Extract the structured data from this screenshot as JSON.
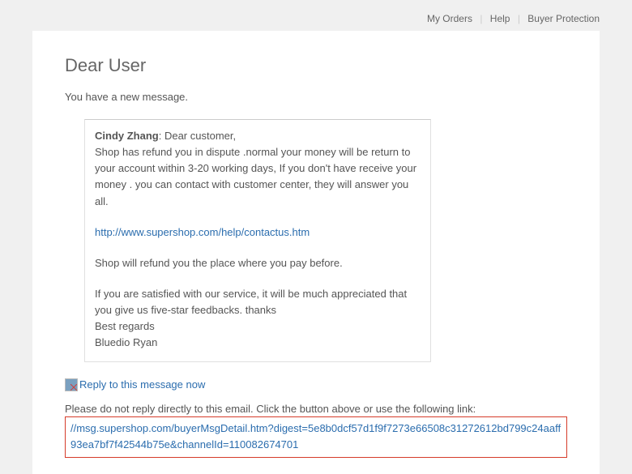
{
  "nav": {
    "my_orders": "My Orders",
    "help": "Help",
    "buyer_protection": "Buyer Protection"
  },
  "salutation": "Dear User",
  "intro": "You have a new message.",
  "message": {
    "sender": "Cindy Zhang",
    "sender_sep": ": ",
    "greeting": "Dear customer,",
    "body1": "Shop has refund you in dispute .normal your money will be return to your account within 3-20 working days, If you don't have receive your money . you can contact with customer center, they will answer you all.",
    "contact_link": "http://www.supershop.com/help/contactus.htm",
    "body2": "Shop will refund you the place where you pay before.",
    "body3": "If you are satisfied with our service, it will be much appreciated that you give us five-star feedbacks. thanks",
    "closing": "Best regards",
    "signature": "Bluedio Ryan"
  },
  "reply_label": "Reply to this message now",
  "footer_text": "Please do not reply directly to this email. Click the button above or use the following link:",
  "direct_link": "//msg.supershop.com/buyerMsgDetail.htm?digest=5e8b0dcf57d1f9f7273e66508c31272612bd799c24aaff93ea7bf7f42544b75e&channelId=110082674701"
}
